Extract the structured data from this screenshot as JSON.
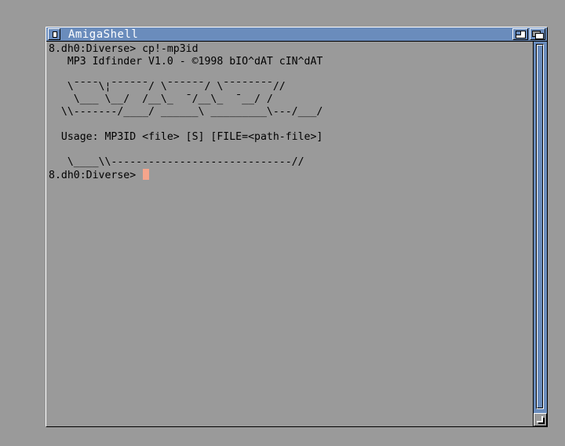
{
  "window": {
    "title": "AmigaShell",
    "title_color": "#ffffff",
    "titlebar_color": "#6a8cbc",
    "background_color": "#9a9a9a"
  },
  "console": {
    "lines": [
      "8.dh0:Diverse> cp!-mp3id",
      "   MP3 Idfinder V1.0 - ©1998 bIO^dAT cIN^dAT",
      "",
      "   \\¯¯¯¯\\¦¯¯¯¯¯¯/ \\¯¯¯¯¯¯/ \\¯¯¯¯¯¯¯¯//",
      "    \\___ \\__/  /__\\_  ¯/__\\_  ¯__/ /",
      "  \\\\-------/____/ ______\\ _________\\---/___/",
      "",
      "  Usage: MP3ID <file> [S] [FILE=<path-file>]",
      "",
      "   \\____\\\\-----------------------------//",
      "8.dh0:Diverse> "
    ],
    "cursor_color": "#f5a58c"
  },
  "icons": {
    "close": "close-gadget-icon",
    "zoom": "zoom-gadget-icon",
    "depth": "depth-gadget-icon",
    "size": "size-gadget-icon"
  }
}
